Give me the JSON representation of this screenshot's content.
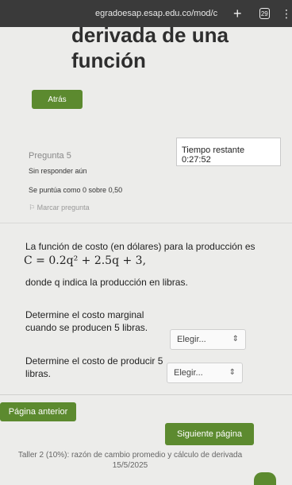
{
  "browser": {
    "url": "egradoesap.esap.edu.co/mod/c",
    "new_tab": "+",
    "tab_count": "29",
    "menu": "⋮"
  },
  "page": {
    "title": "derivada de una función",
    "back_label": "Atrás"
  },
  "timer": {
    "label": "Tiempo restante 0:27:52"
  },
  "question_info": {
    "number_label": "Pregunta 5",
    "status": "Sin responder aún",
    "grade": "Se puntúa como 0 sobre 0,50",
    "flag_label": "Marcar pregunta"
  },
  "question": {
    "intro": "La función de costo (en dólares) para la producción es",
    "formula": "C = 0.2q² + 2.5q + 3,",
    "description": "donde q indica la producción en libras.",
    "parts": [
      {
        "label": "Determine el costo marginal cuando se producen 5 libras.",
        "select_value": "Elegir..."
      },
      {
        "label": "Determine el costo de producir 5 libras.",
        "select_value": "Elegir..."
      }
    ]
  },
  "navigation": {
    "prev_label": "Página anterior",
    "next_label": "Siguiente página",
    "footer_link": "Taller 2 (10%): razón de cambio promedio y cálculo de derivada 15/5/2025"
  },
  "colors": {
    "accent": "#5c8a2f",
    "topbar": "#3a3a3a",
    "background": "#ececea"
  }
}
